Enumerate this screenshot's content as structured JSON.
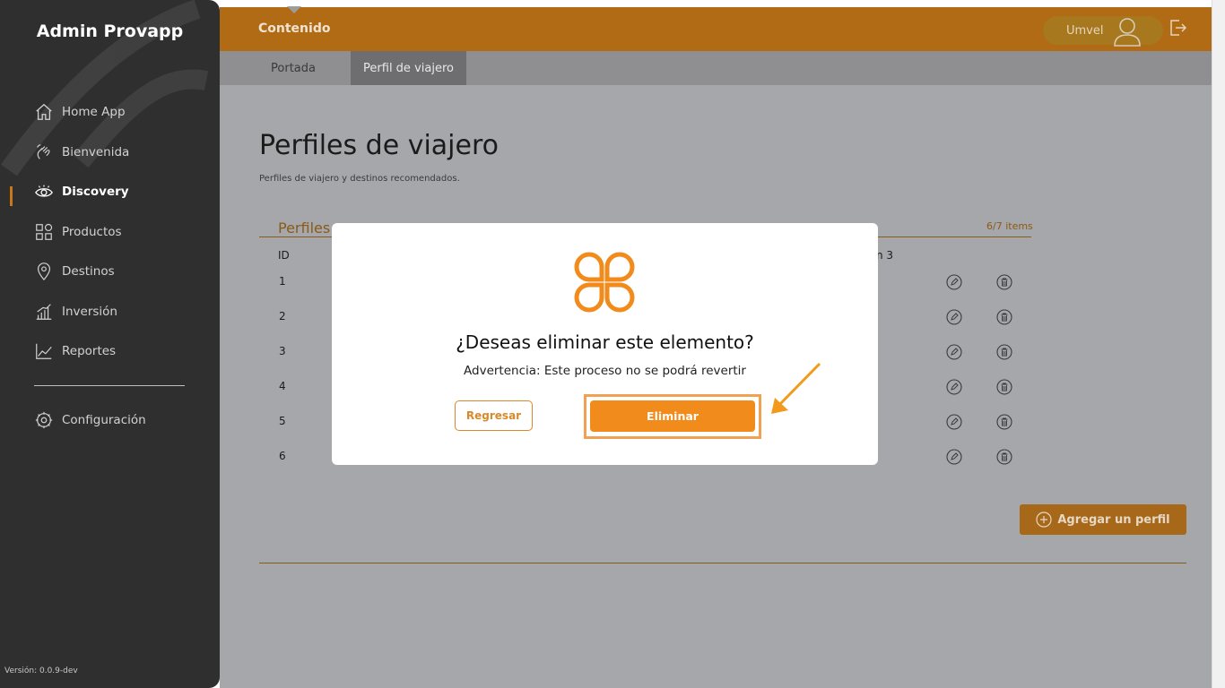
{
  "app": {
    "brand": "Admin Provapp",
    "version": "Versión: 0.0.9-dev"
  },
  "sidebar": {
    "items": [
      {
        "label": "Home App",
        "icon": "home-icon"
      },
      {
        "label": "Bienvenida",
        "icon": "wave-hand-icon"
      },
      {
        "label": "Discovery",
        "icon": "eye-icon",
        "active": true
      },
      {
        "label": "Productos",
        "icon": "grid-icon"
      },
      {
        "label": "Destinos",
        "icon": "location-pin-icon"
      },
      {
        "label": "Inversión",
        "icon": "bar-chart-icon"
      },
      {
        "label": "Reportes",
        "icon": "line-chart-icon"
      }
    ],
    "settings": {
      "label": "Configuración",
      "icon": "gear-icon"
    }
  },
  "header": {
    "section": "Contenido",
    "user": "Umvel"
  },
  "tabs": [
    {
      "label": "Portada"
    },
    {
      "label": "Perfil de viajero",
      "active": true
    }
  ],
  "page": {
    "title": "Perfiles de viajero",
    "subtitle": "Perfiles de viajero y destinos recomendados.",
    "list_title": "Perfiles",
    "count": "6/7 items",
    "columns": {
      "id": "ID",
      "col3": "n 3"
    },
    "rows": [
      "1",
      "2",
      "3",
      "4",
      "5",
      "6"
    ],
    "add_button": "Agregar un perfil"
  },
  "modal": {
    "question": "¿Deseas eliminar este elemento?",
    "warning": "Advertencia: Este proceso no se podrá revertir",
    "back_button": "Regresar",
    "delete_button": "Eliminar"
  },
  "colors": {
    "accent": "#f18b1c",
    "topbar": "#b06b14",
    "sidebar": "#2f2f2f",
    "overlay": "#a6a7ab"
  }
}
